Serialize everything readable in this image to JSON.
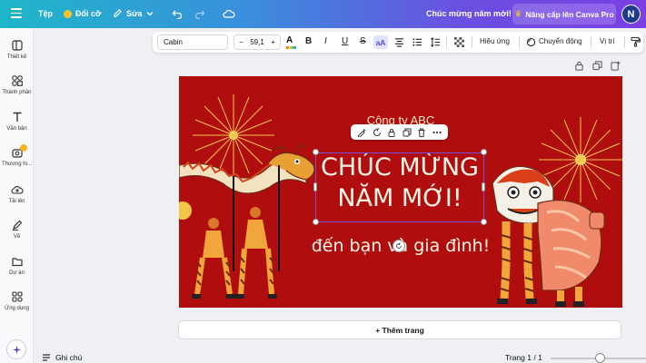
{
  "topbar": {
    "file_label": "Tệp",
    "resize_label": "Đổi cỡ",
    "edit_label": "Sửa",
    "doc_title": "Chúc mừng năm mới!",
    "upgrade_label": "Nâng cấp lên Canva Pro",
    "avatar_initial": "N"
  },
  "sidebar": {
    "items": [
      {
        "label": "Thiết kế",
        "icon": "layout-icon"
      },
      {
        "label": "Thành phần",
        "icon": "shapes-icon"
      },
      {
        "label": "Văn bản",
        "icon": "text-icon"
      },
      {
        "label": "Thương hi...",
        "icon": "brand-icon"
      },
      {
        "label": "Tải lên",
        "icon": "upload-cloud-icon"
      },
      {
        "label": "Vẽ",
        "icon": "draw-icon"
      },
      {
        "label": "Dự án",
        "icon": "folder-icon"
      },
      {
        "label": "Ứng dụng",
        "icon": "apps-icon"
      }
    ]
  },
  "text_toolbar": {
    "font": "Cabin",
    "minus": "−",
    "font_size": "59,1",
    "plus": "+",
    "bold": "B",
    "italic": "I",
    "underline": "U",
    "strike": "S",
    "case": "aA",
    "effects_label": "Hiệu ứng",
    "animate_label": "Chuyển động",
    "position_label": "Vị trí"
  },
  "canvas": {
    "company": "Công ty ABC",
    "headline_line1": "CHÚC MỪNG",
    "headline_line2": "NĂM MỚI!",
    "subline": "đến bạn và gia đình!",
    "background_color": "#b00d0f"
  },
  "bottom": {
    "add_page_label": "+ Thêm trang",
    "notes_label": "Ghi chú",
    "page_indicator": "Trang 1 / 1",
    "zoom_level": 0.47
  }
}
